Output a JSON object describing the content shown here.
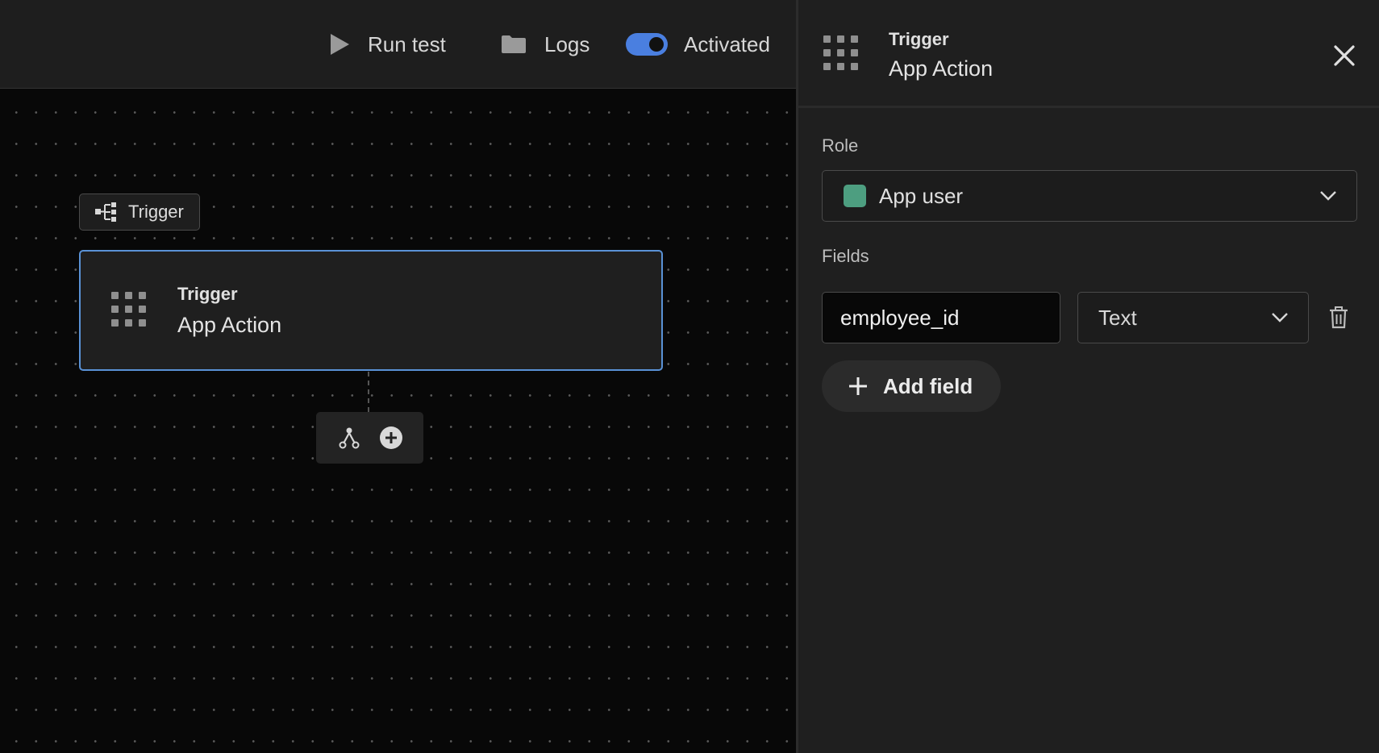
{
  "toolbar": {
    "run_test": "Run test",
    "logs": "Logs",
    "activated": "Activated",
    "toggle_on": true,
    "accent": "#4a7fe0"
  },
  "canvas": {
    "trigger_tag": "Trigger",
    "node": {
      "label": "Trigger",
      "title": "App Action"
    }
  },
  "panel": {
    "header": {
      "label": "Trigger",
      "title": "App Action"
    },
    "role": {
      "label": "Role",
      "value": "App user",
      "swatch_color": "#4d9e80"
    },
    "fields": {
      "label": "Fields",
      "items": [
        {
          "name": "employee_id",
          "type": "Text"
        }
      ],
      "add_label": "Add field"
    }
  },
  "icons": {
    "run": "play-icon",
    "logs": "folder-icon",
    "tag": "flow-tree-icon",
    "node": "grid-icon",
    "branch": "branch-icon",
    "add": "plus-circle-icon",
    "close": "close-icon",
    "dropdown": "chevron-down-icon",
    "delete": "trash-icon",
    "add_field": "plus-icon"
  }
}
